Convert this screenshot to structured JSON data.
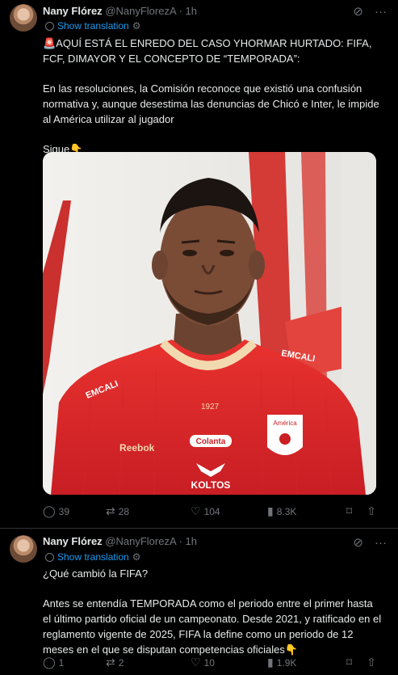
{
  "tweets": [
    {
      "author_name": "Nany Flórez",
      "author_handle": "@NanyFlorezA",
      "separator": "·",
      "time": "1h",
      "show_translation": "Show translation",
      "text": {
        "line1": "🚨AQUÍ ESTÁ EL ENREDO DEL CASO YHORMAR HURTADO: FIFA, FCF, DIMAYOR Y EL CONCEPTO DE “TEMPORADA”:",
        "line2": "En las resoluciones, la Comisión reconoce que existió una confusión normativa y, aunque desestima las denuncias de Chicó e Inter, le impide al América utilizar al jugador",
        "line3": "Sigue👇"
      },
      "media": {
        "alt_icon": "player-photo",
        "sponsor_sleeve": "EMCALI",
        "sponsor_shoulder": "EMCALI",
        "year": "1927",
        "crest": "América",
        "brand": "Reebok",
        "chest": "Colanta",
        "sponsor_main": "KOLTOS"
      },
      "stats": {
        "replies": "39",
        "reposts": "28",
        "likes": "104",
        "views": "8.3K"
      }
    },
    {
      "author_name": "Nany Flórez",
      "author_handle": "@NanyFlorezA",
      "separator": "·",
      "time": "1h",
      "show_translation": "Show translation",
      "text": {
        "line1": "¿Qué cambió la FIFA?",
        "line2": "Antes se entendía TEMPORADA como el periodo entre el primer hasta el último partido oficial de un campeonato. Desde 2021, y ratificado en el reglamento vigente de 2025, FIFA la define como un periodo de 12 meses en el que se disputan competencias oficiales👇"
      },
      "stats": {
        "replies": "1",
        "reposts": "2",
        "likes": "10",
        "views": "1.9K"
      }
    }
  ],
  "colors": {
    "background": "#000000",
    "text": "#e7e9ea",
    "muted": "#71767b",
    "accent": "#1d9bf0",
    "jersey": "#e0262d"
  }
}
